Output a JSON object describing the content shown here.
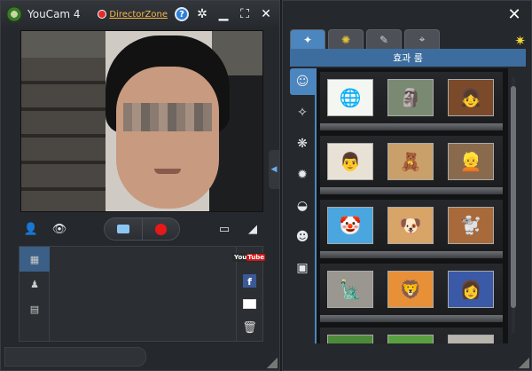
{
  "main_window": {
    "app_title": "YouCam 4",
    "director_zone_label": "DirectorZone",
    "help_label": "?",
    "settings_icon": "gear-icon",
    "minimize_icon": "minimize-icon",
    "fullscreen_icon": "fullscreen-icon",
    "close_icon": "close-icon"
  },
  "controls": {
    "face_tracking_icon": "face-tracking-icon",
    "eye_icon": "eye-icon",
    "capture_icon": "camera-icon",
    "record_icon": "record-icon",
    "ratio_icon": "aspect-ratio-icon",
    "eraser_icon": "eraser-icon"
  },
  "tray": {
    "tabs": [
      "filmstrip-icon",
      "person-icon",
      "film-icon"
    ],
    "side_actions": {
      "youtube_label_a": "You",
      "youtube_label_b": "Tube",
      "facebook_label": "f",
      "mail_icon": "mail-icon",
      "trash_icon": "trash-icon"
    }
  },
  "effects_window": {
    "close_icon": "close-icon",
    "tabs": [
      "magic-wand-icon",
      "sparkle-icon",
      "pencil-icon",
      "cctv-icon"
    ],
    "add_icon": "star-add-icon",
    "section_title": "효과 룸",
    "categories": [
      "avatar-icon",
      "magic-wand-icon",
      "particle-icon",
      "distortion-icon",
      "mask-icon",
      "emotion-icon",
      "frame-icon"
    ],
    "thumbnails": [
      [
        "globe-download-icon",
        "stone-statue-icon",
        "cartoon-girl-icon"
      ],
      [
        "cartoon-man-icon",
        "teddy-bear-icon",
        "blond-man-icon"
      ],
      [
        "clown-icon",
        "dog-icon",
        "poodle-icon"
      ],
      [
        "lincoln-statue-icon",
        "lion-icon",
        "blonde-woman-icon"
      ],
      [
        "pig-icon",
        "pig-icon",
        "statue-icon"
      ]
    ]
  },
  "colors": {
    "accent": "#4c86bf",
    "record": "#e81818",
    "director_zone": "#f7b84a"
  }
}
